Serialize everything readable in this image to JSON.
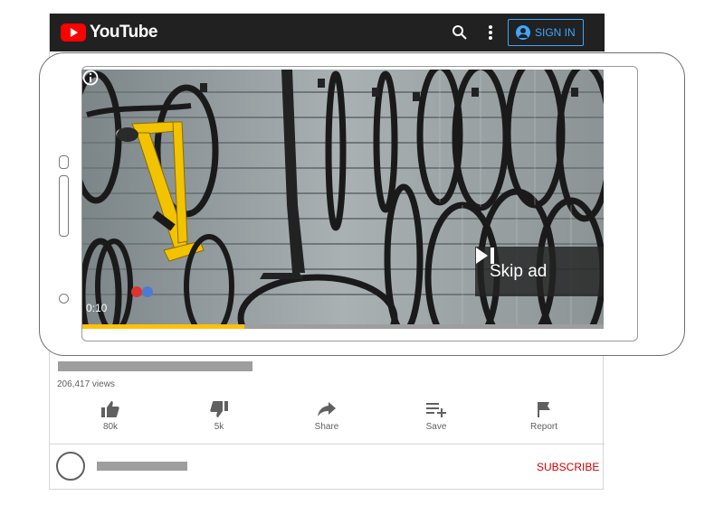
{
  "header": {
    "brand": "YouTube",
    "sign_in": "SIGN IN",
    "icons": [
      "search-icon",
      "more-vert-icon",
      "account-icon"
    ],
    "bg_color": "#212121",
    "accent": "#3ea6ff"
  },
  "video": {
    "skip_label": "Skip ad",
    "time": "0:10",
    "progress": 0.31,
    "progress_color": "#ffc107"
  },
  "meta": {
    "views": "206,417 views"
  },
  "actions": [
    {
      "label": "80k",
      "icon": "thumb-up-icon"
    },
    {
      "label": "5k",
      "icon": "thumb-down-icon"
    },
    {
      "label": "Share",
      "icon": "share-icon"
    },
    {
      "label": "Save",
      "icon": "playlist-add-icon"
    },
    {
      "label": "Report",
      "icon": "flag-icon"
    }
  ],
  "channel": {
    "subscribe": "SUBSCRIBE",
    "subscribe_color": "#cc0000"
  }
}
